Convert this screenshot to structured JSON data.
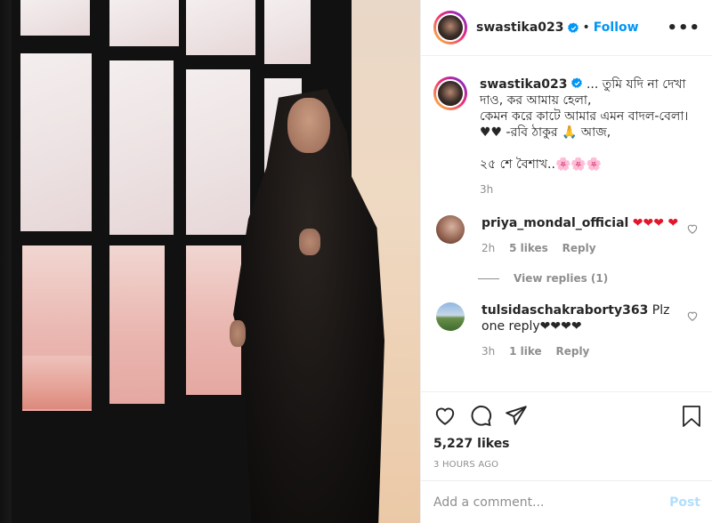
{
  "post": {
    "username": "swastika023",
    "follow_label": "Follow",
    "separator": "•",
    "more_label": "•••"
  },
  "caption": {
    "username": "swastika023",
    "text": " ... তুমি যদি না দেখা দাও, কর আমায় হেলা,\nকেমন করে কাটে আমার এমন বাদল-বেলা। ♥♥ -রবি ঠাকুর 🙏 আজ,\n\n২৫ শে বৈশাখ..🌸🌸🌸",
    "age": "3h"
  },
  "comments": [
    {
      "username": "priya_mondal_official",
      "text": " ❤❤❤ ❤",
      "age": "2h",
      "likes": "5 likes",
      "reply_label": "Reply",
      "view_replies": "View replies (1)"
    },
    {
      "username": "tulsidaschakraborty363",
      "text": " Plz one reply❤❤❤❤",
      "age": "3h",
      "likes": "1 like",
      "reply_label": "Reply"
    }
  ],
  "actions": {
    "likes_count": "5,227 likes",
    "timestamp": "3 HOURS AGO"
  },
  "add_comment": {
    "placeholder": "Add a comment...",
    "post_label": "Post"
  },
  "colors": {
    "accent": "#0095f6",
    "post_disabled": "#b2dffc",
    "heart": "#e0162b",
    "muted": "#8e8e8e"
  },
  "icons": [
    "verified-badge-icon",
    "more-options-icon",
    "heart-icon",
    "comment-icon",
    "share-icon",
    "bookmark-icon"
  ]
}
